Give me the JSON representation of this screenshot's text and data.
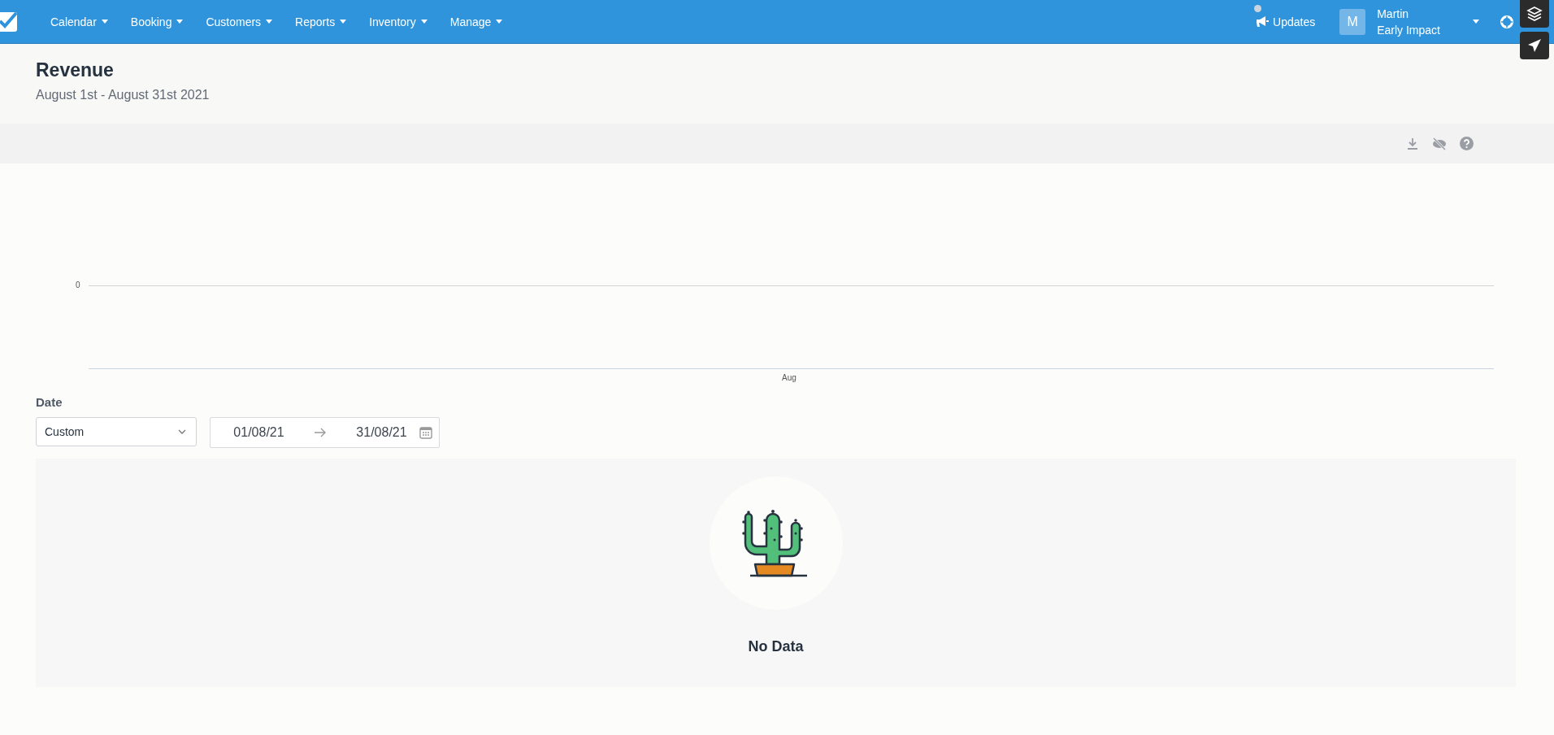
{
  "nav": {
    "items": [
      {
        "label": "Calendar"
      },
      {
        "label": "Booking"
      },
      {
        "label": "Customers"
      },
      {
        "label": "Reports"
      },
      {
        "label": "Inventory"
      },
      {
        "label": "Manage"
      }
    ],
    "updates": "Updates",
    "user": {
      "initial": "M",
      "name": "Martin",
      "company": "Early Impact"
    }
  },
  "header": {
    "title": "Revenue",
    "subtitle": "August 1st - August 31st 2021"
  },
  "chart": {
    "y_tick_labels": [
      "0"
    ],
    "x_labels": [
      "Aug"
    ]
  },
  "filters": {
    "label": "Date",
    "range_select": {
      "value": "Custom"
    },
    "date_range": {
      "start": "01/08/21",
      "end": "31/08/21"
    }
  },
  "empty_state": {
    "message": "No Data"
  }
}
